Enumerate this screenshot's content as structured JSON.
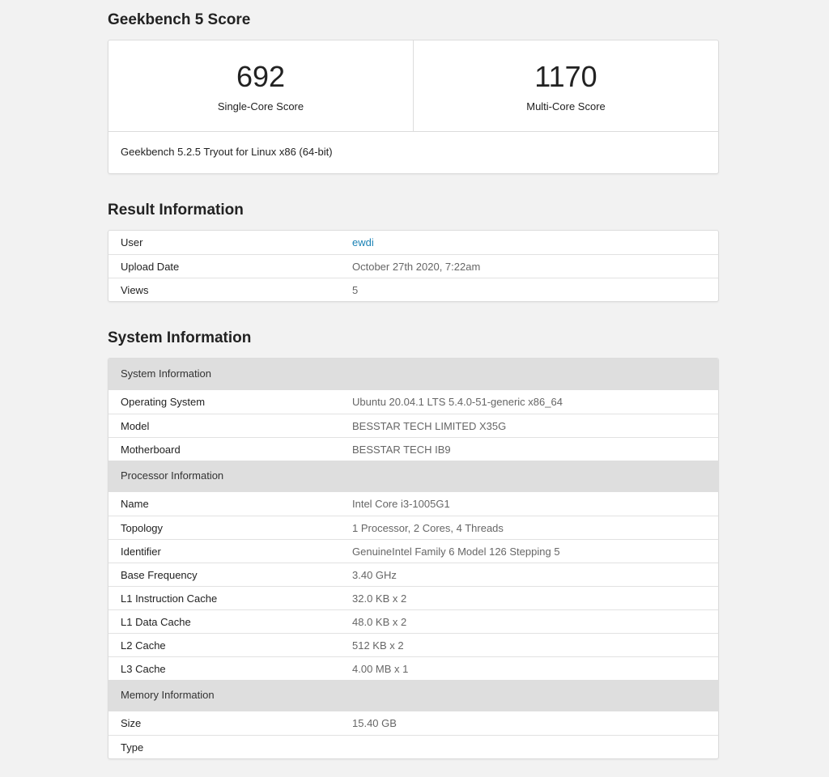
{
  "score_section": {
    "title": "Geekbench 5 Score",
    "single_core": {
      "value": "692",
      "label": "Single-Core Score"
    },
    "multi_core": {
      "value": "1170",
      "label": "Multi-Core Score"
    },
    "footer": "Geekbench 5.2.5 Tryout for Linux x86 (64-bit)"
  },
  "result_section": {
    "title": "Result Information",
    "rows": [
      {
        "key": "User",
        "value": "ewdi"
      },
      {
        "key": "Upload Date",
        "value": "October 27th 2020, 7:22am"
      },
      {
        "key": "Views",
        "value": "5"
      }
    ]
  },
  "system_section": {
    "title": "System Information",
    "groups": [
      {
        "header": "System Information",
        "rows": [
          {
            "key": "Operating System",
            "value": "Ubuntu 20.04.1 LTS 5.4.0-51-generic x86_64"
          },
          {
            "key": "Model",
            "value": "BESSTAR TECH LIMITED X35G"
          },
          {
            "key": "Motherboard",
            "value": "BESSTAR TECH IB9"
          }
        ]
      },
      {
        "header": "Processor Information",
        "rows": [
          {
            "key": "Name",
            "value": "Intel Core i3-1005G1"
          },
          {
            "key": "Topology",
            "value": "1 Processor, 2 Cores, 4 Threads"
          },
          {
            "key": "Identifier",
            "value": "GenuineIntel Family 6 Model 126 Stepping 5"
          },
          {
            "key": "Base Frequency",
            "value": "3.40 GHz"
          },
          {
            "key": "L1 Instruction Cache",
            "value": "32.0 KB x 2"
          },
          {
            "key": "L1 Data Cache",
            "value": "48.0 KB x 2"
          },
          {
            "key": "L2 Cache",
            "value": "512 KB x 2"
          },
          {
            "key": "L3 Cache",
            "value": "4.00 MB x 1"
          }
        ]
      },
      {
        "header": "Memory Information",
        "rows": [
          {
            "key": "Size",
            "value": "15.40 GB"
          },
          {
            "key": "Type",
            "value": ""
          }
        ]
      }
    ]
  },
  "colors": {
    "background": "#f2f2f2",
    "link": "#1a82b5",
    "group_header": "#dedede"
  }
}
